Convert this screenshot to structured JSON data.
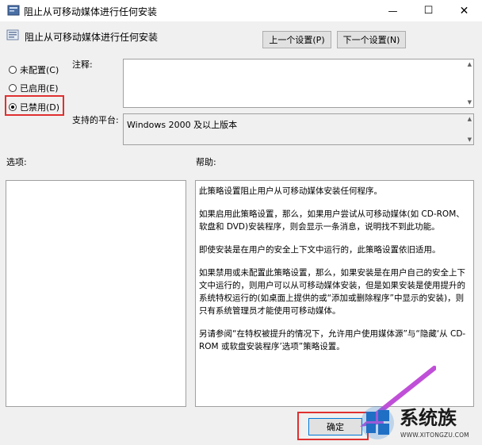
{
  "window": {
    "title": "阻止从可移动媒体进行任何安装",
    "minimize": "—",
    "maximize": "☐",
    "close": "✕"
  },
  "header": {
    "policy_title": "阻止从可移动媒体进行任何安装",
    "prev_button": "上一个设置(P)",
    "next_button": "下一个设置(N)"
  },
  "state": {
    "options": [
      {
        "label": "未配置(C)",
        "checked": false
      },
      {
        "label": "已启用(E)",
        "checked": false
      },
      {
        "label": "已禁用(D)",
        "checked": true
      }
    ]
  },
  "comment": {
    "label": "注释:",
    "value": ""
  },
  "platform": {
    "label": "支持的平台:",
    "value": "Windows 2000 及以上版本"
  },
  "options_section": {
    "label": "选项:"
  },
  "help_section": {
    "label": "帮助:",
    "paragraphs": [
      "此策略设置阻止用户从可移动媒体安装任何程序。",
      "如果启用此策略设置，那么，如果用户尝试从可移动媒体(如 CD-ROM、软盘和 DVD)安装程序，则会显示一条消息，说明找不到此功能。",
      "即使安装是在用户的安全上下文中运行的，此策略设置依旧适用。",
      "如果禁用或未配置此策略设置，那么，如果安装是在用户自己的安全上下文中运行的，则用户可以从可移动媒体安装，但是如果安装是使用提升的系统特权运行的(如桌面上提供的或“添加或删除程序”中显示的安装)，则只有系统管理员才能使用可移动媒体。",
      "另请参阅“在特权被提升的情况下，允许用户使用媒体源”与“隐藏‘从 CD-ROM 或软盘安装程序’选项”策略设置。"
    ]
  },
  "footer": {
    "ok_button": "确定"
  },
  "watermark": {
    "brand": "系统族",
    "url": "WWW.XITONGZU.COM"
  },
  "colors": {
    "highlight_box": "#e03030",
    "arrow": "#c04fd8"
  }
}
